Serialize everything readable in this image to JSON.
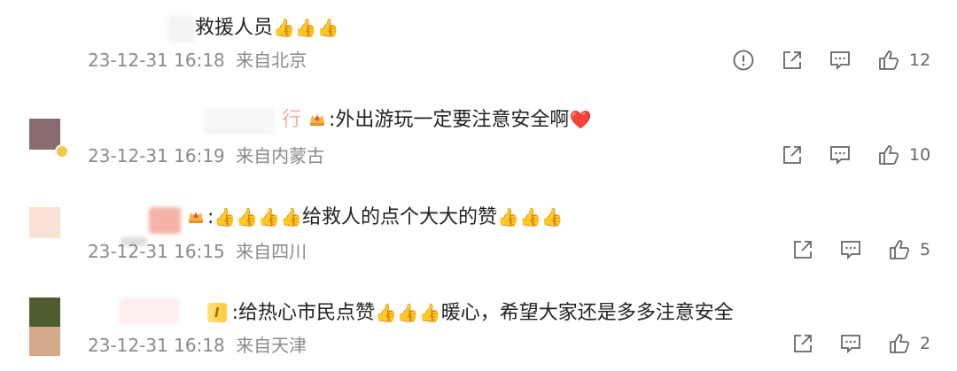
{
  "comments": [
    {
      "text": "救援人员",
      "emojis": "👍👍👍",
      "time": "23-12-31 16:18",
      "loc_prefix": "来自",
      "location": "北京",
      "likes": "12",
      "icons": [
        "report-icon",
        "share-icon",
        "reply-icon",
        "like-icon"
      ]
    },
    {
      "name_tail": "行",
      "text": ":外出游玩一定要注意安全啊",
      "emojis": "❤️",
      "time": "23-12-31 16:19",
      "loc_prefix": "来自",
      "location": "内蒙古",
      "likes": "10",
      "icons": [
        "share-icon",
        "reply-icon",
        "like-icon"
      ]
    },
    {
      "text_prefix": ":",
      "emojis_before": "👍👍👍👍",
      "text": "给救人的点个大大的赞",
      "emojis": "👍👍👍",
      "time": "23-12-31 16:15",
      "loc_prefix": "来自",
      "location": "四川",
      "likes": "5",
      "icons": [
        "share-icon",
        "reply-icon",
        "like-icon"
      ]
    },
    {
      "level_badge": "I",
      "text": ":给热心市民点赞",
      "emojis": "👍👍👍",
      "text_after": "暖心，希望大家还是多多注意安全",
      "time": "23-12-31 16:18",
      "loc_prefix": "来自",
      "location": "天津",
      "likes": "2",
      "icons": [
        "share-icon",
        "reply-icon",
        "like-icon"
      ]
    }
  ]
}
